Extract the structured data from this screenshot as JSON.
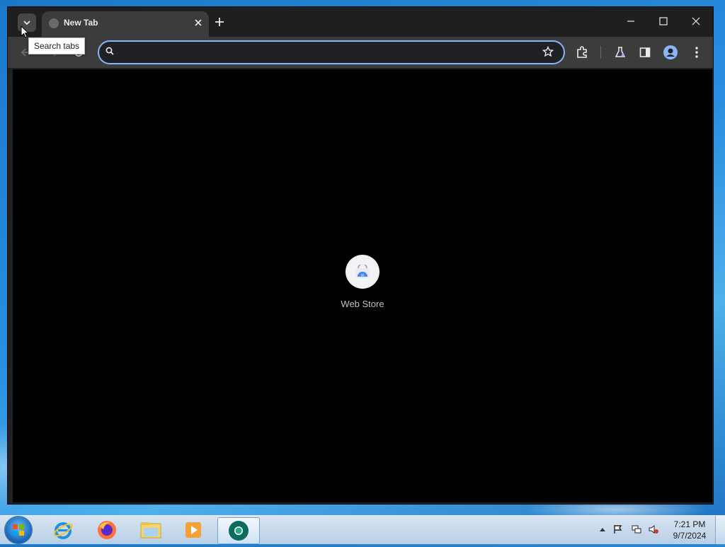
{
  "browser": {
    "tab_search_tooltip": "Search tabs",
    "tabs": [
      {
        "title": "New Tab"
      }
    ],
    "omnibox": {
      "value": "",
      "placeholder": ""
    },
    "shortcuts": [
      {
        "label": "Web Store"
      }
    ]
  },
  "taskbar": {
    "pinned": [
      "internet-explorer-icon",
      "firefox-icon",
      "file-explorer-icon",
      "media-player-icon",
      "chrome-dev-icon"
    ],
    "clock_time": "7:21 PM",
    "clock_date": "9/7/2024"
  },
  "colors": {
    "focus_ring": "#8ab4f8",
    "tab_bg": "#3c3c3c",
    "content_bg": "#000000"
  }
}
